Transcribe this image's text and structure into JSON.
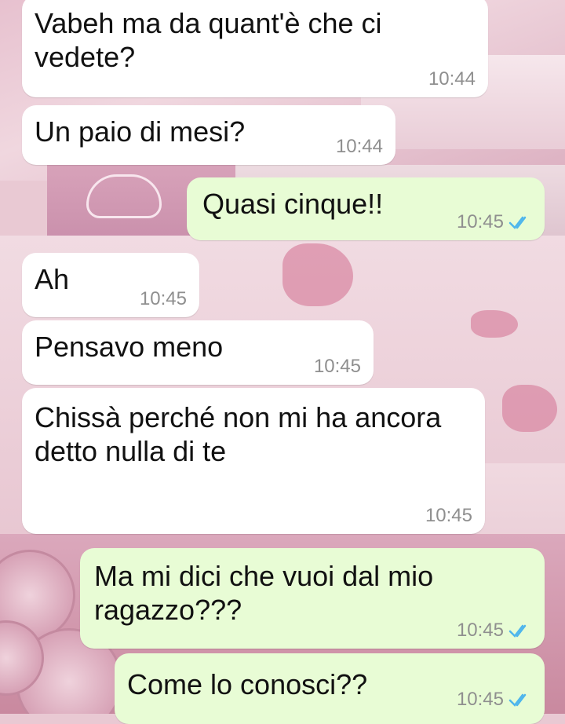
{
  "messages": [
    {
      "id": "m1",
      "side": "in",
      "text": "Vabeh ma da quant'è che ci vedete?",
      "time": "10:44",
      "status": null
    },
    {
      "id": "m2",
      "side": "in",
      "text": "Un paio di mesi?",
      "time": "10:44",
      "status": null
    },
    {
      "id": "m3",
      "side": "out",
      "text": "Quasi cinque!!",
      "time": "10:45",
      "status": "read"
    },
    {
      "id": "m4",
      "side": "in",
      "text": "Ah",
      "time": "10:45",
      "status": null
    },
    {
      "id": "m5",
      "side": "in",
      "text": "Pensavo meno",
      "time": "10:45",
      "status": null
    },
    {
      "id": "m6",
      "side": "in",
      "text": "Chissà perché non mi ha ancora detto nulla di te",
      "time": "10:45",
      "status": null
    },
    {
      "id": "m7",
      "side": "out",
      "text": "Ma mi dici che vuoi dal mio ragazzo???",
      "time": "10:45",
      "status": "read"
    },
    {
      "id": "m8",
      "side": "out",
      "text": "Come lo conosci??",
      "time": "10:45",
      "status": "read"
    }
  ],
  "colors": {
    "incoming_bubble": "#ffffff",
    "outgoing_bubble": "#e8fcd5",
    "read_tick": "#4fb6ec",
    "timestamp": "#8f8f8f"
  },
  "icons": {
    "read_receipt": "double-check-icon"
  }
}
